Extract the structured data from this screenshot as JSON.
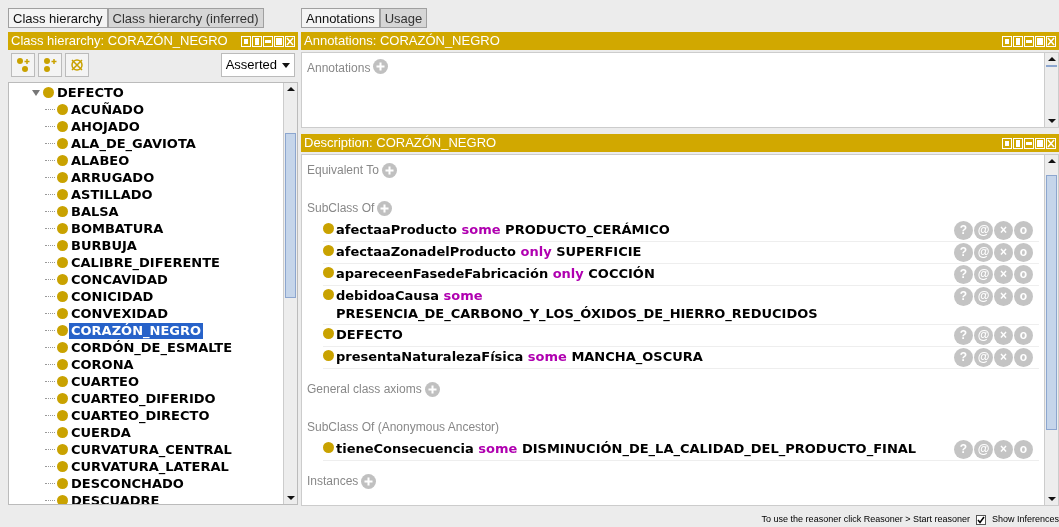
{
  "left": {
    "tabs": [
      {
        "label": "Class hierarchy",
        "selected": true
      },
      {
        "label": "Class hierarchy (inferred)",
        "selected": false
      }
    ],
    "header": "Class hierarchy: CORAZÓN_NEGRO",
    "mode": "Asserted",
    "tree": [
      {
        "label": "DEFECTO",
        "expanded": true,
        "selected": false,
        "children": [
          {
            "label": "ACUÑADO",
            "selected": false
          },
          {
            "label": "AHOJADO",
            "selected": false
          },
          {
            "label": "ALA_DE_GAVIOTA",
            "selected": false
          },
          {
            "label": "ALABEO",
            "selected": false
          },
          {
            "label": "ARRUGADO",
            "selected": false
          },
          {
            "label": "ASTILLADO",
            "selected": false
          },
          {
            "label": "BALSA",
            "selected": false
          },
          {
            "label": "BOMBATURA",
            "selected": false
          },
          {
            "label": "BURBUJA",
            "selected": false
          },
          {
            "label": "CALIBRE_DIFERENTE",
            "selected": false
          },
          {
            "label": "CONCAVIDAD",
            "selected": false
          },
          {
            "label": "CONICIDAD",
            "selected": false
          },
          {
            "label": "CONVEXIDAD",
            "selected": false
          },
          {
            "label": "CORAZÓN_NEGRO",
            "selected": true
          },
          {
            "label": "CORDÓN_DE_ESMALTE",
            "selected": false
          },
          {
            "label": "CORONA",
            "selected": false
          },
          {
            "label": "CUARTEO",
            "selected": false
          },
          {
            "label": "CUARTEO_DIFERIDO",
            "selected": false
          },
          {
            "label": "CUARTEO_DIRECTO",
            "selected": false
          },
          {
            "label": "CUERDA",
            "selected": false
          },
          {
            "label": "CURVATURA_CENTRAL",
            "selected": false
          },
          {
            "label": "CURVATURA_LATERAL",
            "selected": false
          },
          {
            "label": "DESCONCHADO",
            "selected": false
          },
          {
            "label": "DESCUADRE",
            "selected": false
          }
        ]
      }
    ]
  },
  "right": {
    "tabs": [
      {
        "label": "Annotations",
        "selected": true
      },
      {
        "label": "Usage",
        "selected": false
      }
    ],
    "annotations_header": "Annotations: CORAZÓN_NEGRO",
    "annotations_label": "Annotations",
    "description_header": "Description: CORAZÓN_NEGRO",
    "sections": [
      {
        "title": "Equivalent To",
        "addable": true
      },
      {
        "title": "SubClass Of",
        "addable": true,
        "axioms": [
          {
            "parts": [
              {
                "kind": "property",
                "text": "afectaaProducto"
              },
              {
                "kind": "keyword",
                "text": "some"
              },
              {
                "kind": "class",
                "text": "PRODUCTO_CERÁMICO"
              }
            ],
            "buttons": [
              "?",
              "@",
              "×",
              "o"
            ]
          },
          {
            "parts": [
              {
                "kind": "property",
                "text": "afectaaZonadelProducto"
              },
              {
                "kind": "keyword",
                "text": "only"
              },
              {
                "kind": "class",
                "text": "SUPERFICIE"
              }
            ],
            "buttons": [
              "?",
              "@",
              "×",
              "o"
            ]
          },
          {
            "parts": [
              {
                "kind": "property",
                "text": "apareceenFasedeFabricación"
              },
              {
                "kind": "keyword",
                "text": "only"
              },
              {
                "kind": "class",
                "text": "COCCIÓN"
              }
            ],
            "buttons": [
              "?",
              "@",
              "×",
              "o"
            ]
          },
          {
            "parts": [
              {
                "kind": "property",
                "text": "debidoaCausa"
              },
              {
                "kind": "keyword",
                "text": "some"
              },
              {
                "kind": "class",
                "text": "PRESENCIA_DE_CARBONO_Y_LOS_ÓXIDOS_DE_HIERRO_REDUCIDOS"
              }
            ],
            "buttons": [
              "?",
              "@",
              "×",
              "o"
            ]
          },
          {
            "parts": [
              {
                "kind": "class",
                "text": "DEFECTO"
              }
            ],
            "buttons": [
              "?",
              "@",
              "×",
              "o"
            ]
          },
          {
            "parts": [
              {
                "kind": "property",
                "text": "presentaNaturalezaFísica"
              },
              {
                "kind": "keyword",
                "text": "some"
              },
              {
                "kind": "class",
                "text": "MANCHA_OSCURA"
              }
            ],
            "buttons": [
              "?",
              "@",
              "×",
              "o"
            ]
          }
        ]
      },
      {
        "title": "General class axioms",
        "addable": true
      },
      {
        "title": "SubClass Of (Anonymous Ancestor)",
        "addable": false,
        "axioms": [
          {
            "parts": [
              {
                "kind": "property",
                "text": "tieneConsecuencia"
              },
              {
                "kind": "keyword",
                "text": "some"
              },
              {
                "kind": "class",
                "text": "DISMINUCIÓN_DE_LA_CALIDAD_DEL_PRODUCTO_FINAL"
              }
            ],
            "buttons": [
              "?",
              "@",
              "×",
              "o"
            ]
          }
        ]
      },
      {
        "title": "Instances",
        "addable": true
      }
    ]
  },
  "status_bar": {
    "message": "To use the reasoner click Reasoner > Start reasoner",
    "show_inferences": {
      "label": "Show Inferences",
      "checked": true
    }
  }
}
